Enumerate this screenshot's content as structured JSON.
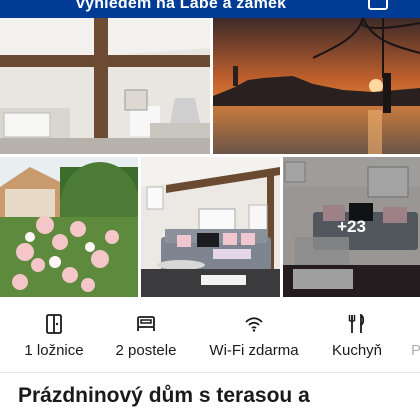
{
  "header": {
    "title": "výhledem na Labe a zámek"
  },
  "gallery": {
    "more_photos_label": "+23"
  },
  "facilities": [
    {
      "label": "1 ložnice",
      "icon": "door-icon"
    },
    {
      "label": "2 postele",
      "icon": "bed-icon"
    },
    {
      "label": "Wi-Fi zdarma",
      "icon": "wifi-icon"
    },
    {
      "label": "Kuchyň",
      "icon": "kitchen-icon"
    },
    {
      "label": "P",
      "icon": "partial-icon"
    }
  ],
  "property": {
    "title": "Prázdninový dům s terasou a"
  },
  "colors": {
    "brand": "#003b95"
  }
}
